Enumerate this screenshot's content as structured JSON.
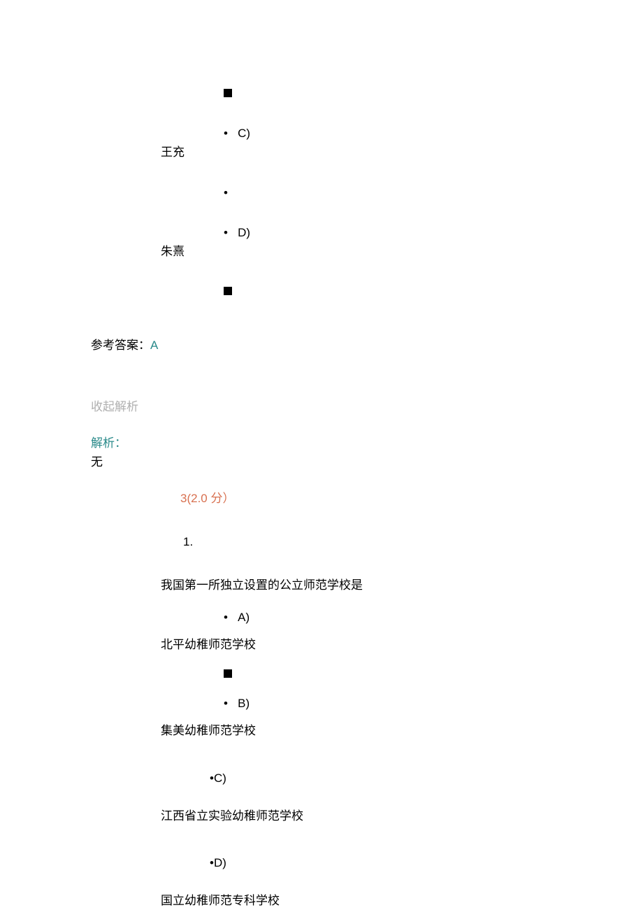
{
  "q2": {
    "optionC": {
      "label": "C)",
      "text": "王充"
    },
    "optionD": {
      "label": "D)",
      "text": "朱熹"
    },
    "answer": {
      "label": "参考答案：",
      "value": "A"
    },
    "collapse": "收起解析",
    "analysis": {
      "label": "解析：",
      "value": "无"
    }
  },
  "q3": {
    "number": "3(2.0 分）",
    "subNumber": "1.",
    "text": "我国第一所独立设置的公立师范学校是",
    "optionA": {
      "label": "A)",
      "text": "北平幼稚师范学校"
    },
    "optionB": {
      "label": "B)",
      "text": "集美幼稚师范学校"
    },
    "optionC": {
      "label": "C)",
      "text": "江西省立实验幼稚师范学校"
    },
    "optionD": {
      "label": "D)",
      "text": "国立幼稚师范专科学校"
    }
  },
  "bullet": "•"
}
